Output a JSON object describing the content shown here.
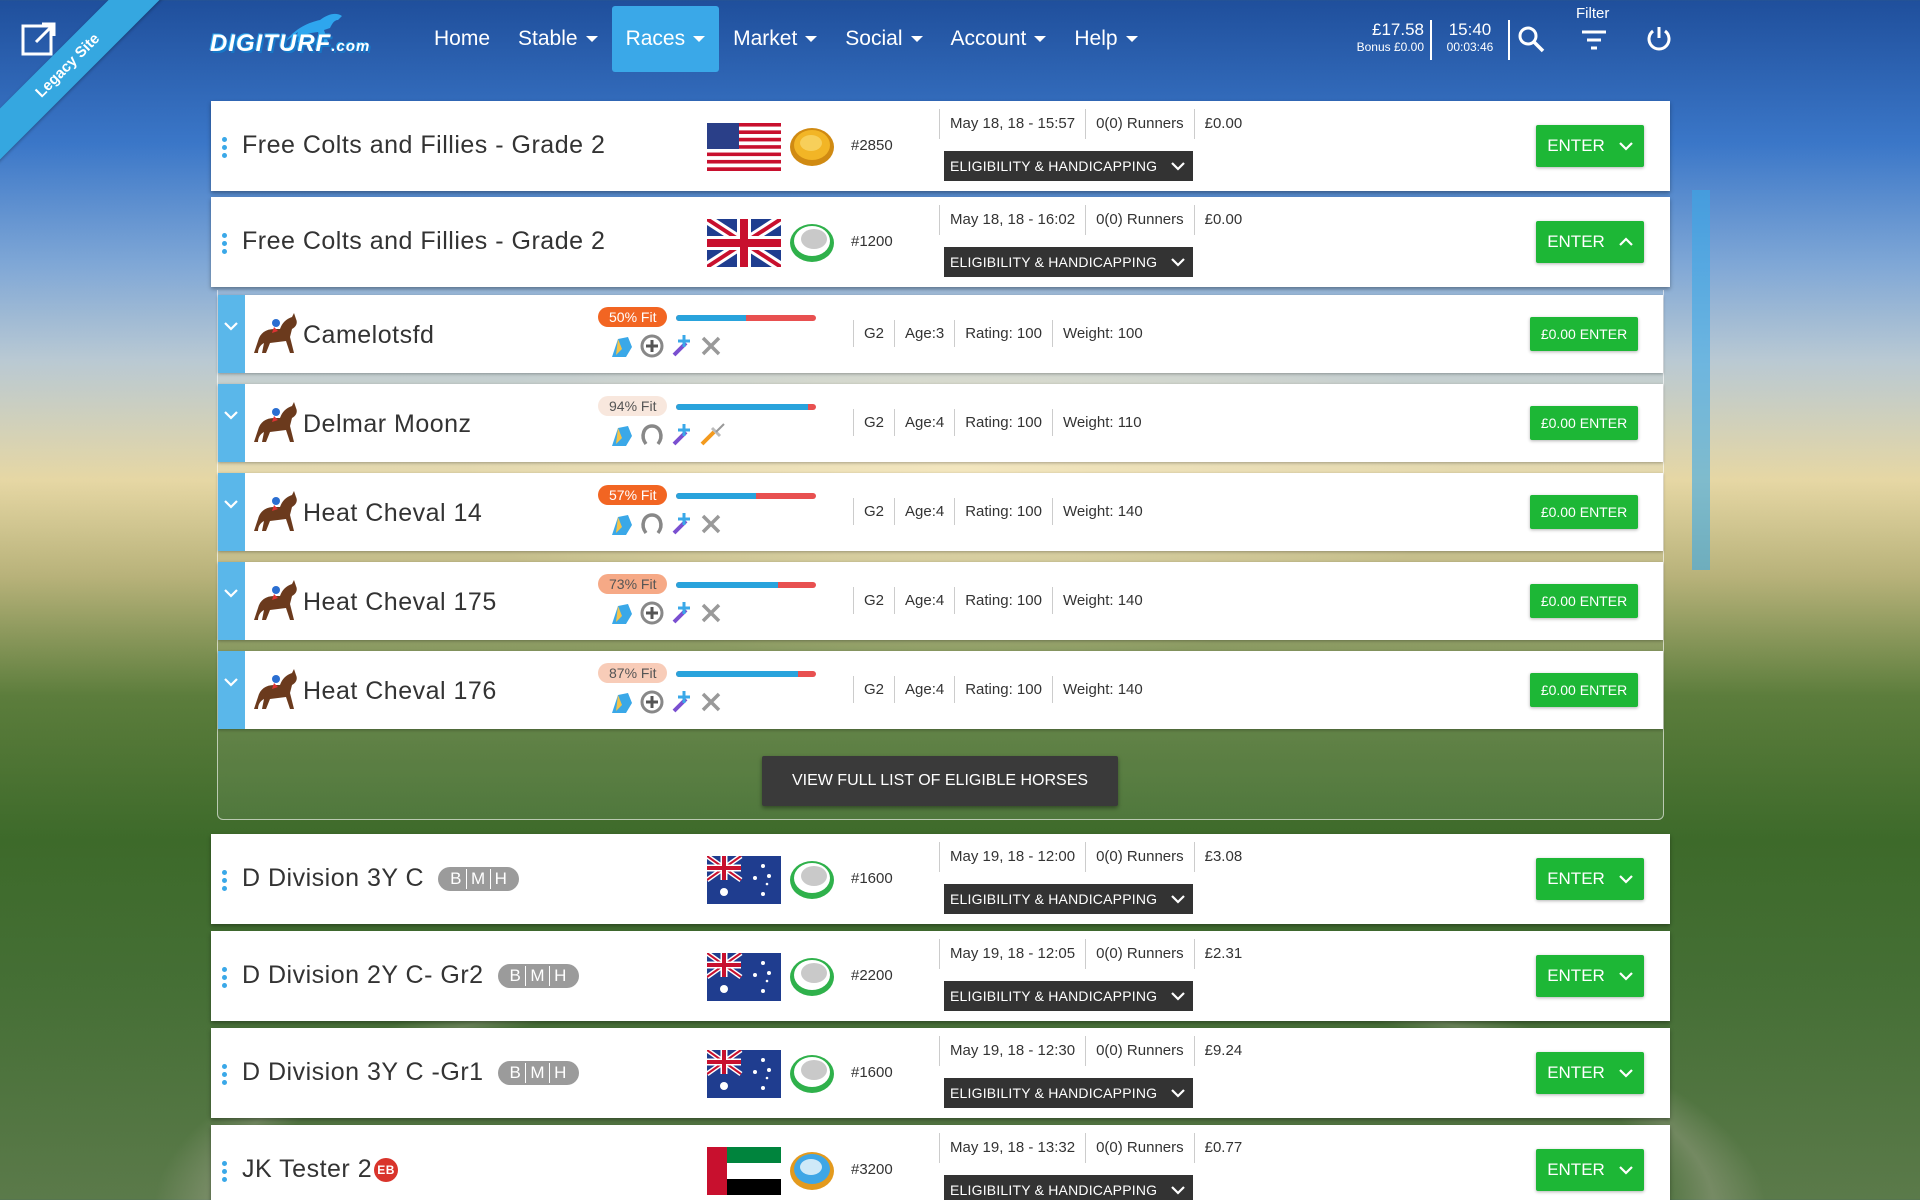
{
  "legacy": {
    "label": "Legacy Site"
  },
  "nav": {
    "logo": "DIGITURF",
    "logo_suffix": ".com",
    "items": [
      {
        "label": "Home",
        "caret": false
      },
      {
        "label": "Stable",
        "caret": true
      },
      {
        "label": "Races",
        "caret": true,
        "active": true
      },
      {
        "label": "Market",
        "caret": true
      },
      {
        "label": "Social",
        "caret": true
      },
      {
        "label": "Account",
        "caret": true
      },
      {
        "label": "Help",
        "caret": true
      }
    ],
    "balance": "£17.58",
    "bonus": "Bonus £0.00",
    "time": "15:40",
    "elapsed": "00:03:46",
    "filter_label": "Filter"
  },
  "races": [
    {
      "name": "Free Colts and Fillies - Grade 2",
      "flag": "us-flag",
      "surface": "dirt-icon",
      "id": "#2850",
      "date": "May 18, 18 - 15:57",
      "runners": "0(0) Runners",
      "prize": "£0.00",
      "elig": "ELIGIBILITY & HANDICAPPING",
      "enter": "ENTER",
      "expanded": false,
      "bmh": false
    },
    {
      "name": "Free Colts and Fillies - Grade 2",
      "flag": "uk-flag",
      "surface": "turf-icon",
      "id": "#1200",
      "date": "May 18, 18 - 16:02",
      "runners": "0(0) Runners",
      "prize": "£0.00",
      "elig": "ELIGIBILITY & HANDICAPPING",
      "enter": "ENTER",
      "expanded": true,
      "bmh": false
    },
    {
      "name": "D Division 3Y C",
      "flag": "au-flag",
      "surface": "turf-icon",
      "id": "#1600",
      "date": "May 19, 18 - 12:00",
      "runners": "0(0) Runners",
      "prize": "£3.08",
      "elig": "ELIGIBILITY & HANDICAPPING",
      "enter": "ENTER",
      "expanded": false,
      "bmh": true
    },
    {
      "name": "D Division 2Y C- Gr2",
      "flag": "au-flag",
      "surface": "turf-icon",
      "id": "#2200",
      "date": "May 19, 18 - 12:05",
      "runners": "0(0) Runners",
      "prize": "£2.31",
      "elig": "ELIGIBILITY & HANDICAPPING",
      "enter": "ENTER",
      "expanded": false,
      "bmh": true
    },
    {
      "name": "D Division 3Y C -Gr1",
      "flag": "au-flag",
      "surface": "turf-icon",
      "id": "#1600",
      "date": "May 19, 18 - 12:30",
      "runners": "0(0) Runners",
      "prize": "£9.24",
      "elig": "ELIGIBILITY & HANDICAPPING",
      "enter": "ENTER",
      "expanded": false,
      "bmh": true
    },
    {
      "name": "JK Tester 2",
      "flag": "uae-flag",
      "surface": "allweather-icon",
      "id": "#3200",
      "date": "May 19, 18 - 13:32",
      "runners": "0(0) Runners",
      "prize": "£0.77",
      "elig": "ELIGIBILITY & HANDICAPPING",
      "enter": "ENTER",
      "expanded": false,
      "bmh": false,
      "eb": "EB"
    }
  ],
  "bmh_letters": [
    "B",
    "M",
    "H"
  ],
  "horses": [
    {
      "name": "Camelotsfd",
      "fit_label": "50% Fit",
      "fit": 0.5,
      "fit_color": "#f26522",
      "fit_text": "#ffffff",
      "grade": "G2",
      "age": "Age:3",
      "rating": "Rating: 100",
      "weight": "Weight: 100",
      "enter": "£0.00 ENTER"
    },
    {
      "name": "Delmar Moonz",
      "fit_label": "94% Fit",
      "fit": 0.94,
      "fit_color": "#f8e7dd",
      "fit_text": "#555555",
      "grade": "G2",
      "age": "Age:4",
      "rating": "Rating: 100",
      "weight": "Weight: 110",
      "enter": "£0.00 ENTER"
    },
    {
      "name": "Heat Cheval 14",
      "fit_label": "57% Fit",
      "fit": 0.57,
      "fit_color": "#f26522",
      "fit_text": "#ffffff",
      "grade": "G2",
      "age": "Age:4",
      "rating": "Rating: 100",
      "weight": "Weight: 140",
      "enter": "£0.00 ENTER"
    },
    {
      "name": "Heat Cheval 175",
      "fit_label": "73% Fit",
      "fit": 0.73,
      "fit_color": "#f6a986",
      "fit_text": "#555555",
      "grade": "G2",
      "age": "Age:4",
      "rating": "Rating: 100",
      "weight": "Weight: 140",
      "enter": "£0.00 ENTER"
    },
    {
      "name": "Heat Cheval 176",
      "fit_label": "87% Fit",
      "fit": 0.87,
      "fit_color": "#f8ccb8",
      "fit_text": "#555555",
      "grade": "G2",
      "age": "Age:4",
      "rating": "Rating: 100",
      "weight": "Weight: 140",
      "enter": "£0.00 ENTER"
    }
  ],
  "view_full": "VIEW FULL LIST OF ELIGIBLE HORSES",
  "colors": {
    "accent": "#3aa8e8",
    "enter_green": "#1db736",
    "dark_button": "#333333"
  }
}
